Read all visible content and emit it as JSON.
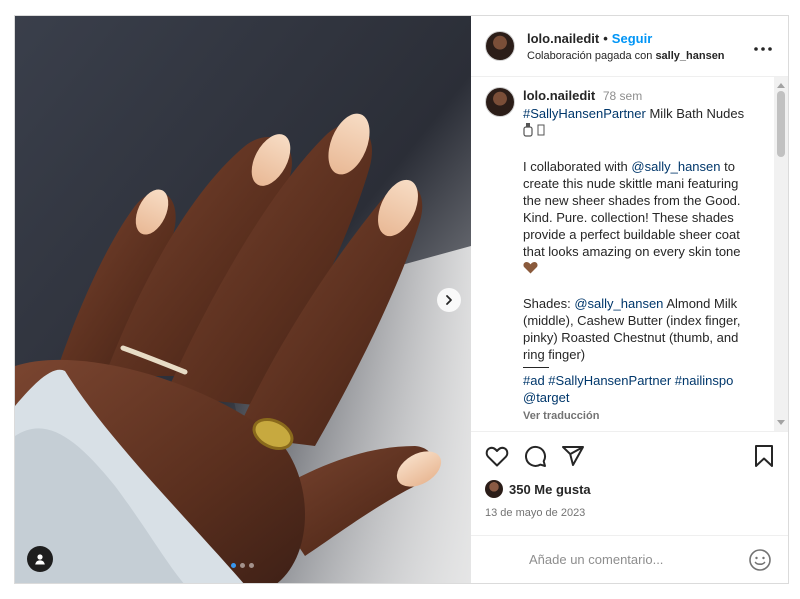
{
  "header": {
    "username": "lolo.nailedit",
    "separator": "•",
    "follow_label": "Seguir",
    "paid_partnership_prefix": "Colaboración pagada con",
    "partner": "sally_hansen"
  },
  "caption": {
    "username": "lolo.nailedit",
    "time": "78 sem",
    "line1_tag": "#SallyHansenPartner",
    "line1_text": " Milk Bath Nudes",
    "para1_prefix": "I collaborated with ",
    "para1_mention": "@sally_hansen",
    "para1_suffix": " to create this nude skittle mani featuring the new sheer shades from the Good. Kind. Pure. collection! These shades provide a perfect buildable sheer coat that looks amazing on every skin tone",
    "para2_prefix": "Shades: ",
    "para2_mention": "@sally_hansen",
    "para2_suffix": " Almond Milk (middle), Cashew Butter (index finger, pinky) Roasted Chestnut (thumb, and ring finger)",
    "tags_line": "#ad #SallyHansenPartner #nailinspo",
    "tags_line2": "@target",
    "translate_label": "Ver traducción"
  },
  "stats": {
    "likes": "350 Me gusta",
    "date": "13 de mayo de 2023"
  },
  "comment": {
    "placeholder": "Añade un comentario..."
  },
  "carousel": {
    "slide_count": 3,
    "active_slide": 1
  },
  "colors": {
    "accent": "#0095f6",
    "hashtag": "#00376b",
    "skin": "#5e3422",
    "nail": "#f1c9a8"
  },
  "icons": [
    "heart-icon",
    "comment-icon",
    "share-icon",
    "bookmark-icon",
    "more-icon",
    "chevron-right-icon",
    "user-tag-icon",
    "emoji-icon"
  ]
}
